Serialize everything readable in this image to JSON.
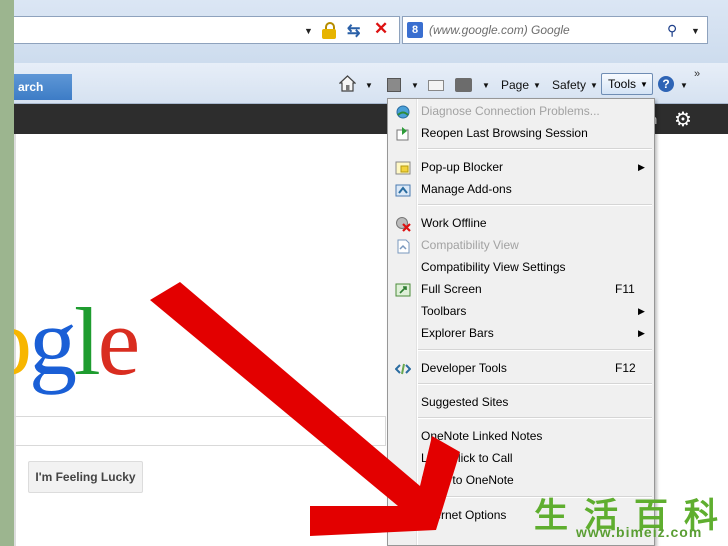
{
  "address_bar": {
    "dropdown_icon": "chevron-down",
    "lock_icon": "lock",
    "refresh_icon": "refresh",
    "stop_icon": "stop-x"
  },
  "search_box": {
    "provider_icon": "google-g",
    "provider_letter": "8",
    "placeholder": "(www.google.com) Google",
    "search_icon": "magnifier"
  },
  "tab": {
    "label": "arch"
  },
  "command_bar": {
    "home_icon": "home",
    "feeds_icon": "rss-feed",
    "mail_icon": "read-mail",
    "print_icon": "printer",
    "page": "Page",
    "safety": "Safety",
    "tools": "Tools",
    "help_glyph": "?",
    "overflow": "»"
  },
  "page_black_bar": {
    "partial_text": "n",
    "gear_icon": "gear"
  },
  "google_page": {
    "logo_text": "oogle",
    "lucky_button": "I'm Feeling Lucky"
  },
  "tools_menu": {
    "groups": [
      [
        {
          "label": "Diagnose Connection Problems...",
          "disabled": true,
          "icon": "diagnose-globe"
        },
        {
          "label": "Reopen Last Browsing Session",
          "disabled": false,
          "icon": "reopen-session"
        }
      ],
      [
        {
          "label": "Pop-up Blocker",
          "submenu": true,
          "icon": "popup-blocker"
        },
        {
          "label": "Manage Add-ons",
          "icon": "addons"
        }
      ],
      [
        {
          "label": "Work Offline",
          "icon": "work-offline"
        },
        {
          "label": "Compatibility View",
          "disabled": true,
          "icon": "compat-view"
        },
        {
          "label": "Compatibility View Settings"
        },
        {
          "label": "Full Screen",
          "shortcut": "F11",
          "icon": "fullscreen"
        },
        {
          "label": "Toolbars",
          "submenu": true
        },
        {
          "label": "Explorer Bars",
          "submenu": true
        }
      ],
      [
        {
          "label": "Developer Tools",
          "shortcut": "F12",
          "icon": "developer-tools"
        }
      ],
      [
        {
          "label": "Suggested Sites"
        }
      ],
      [
        {
          "label": "OneNote Linked Notes"
        },
        {
          "label": "Lync Click to Call"
        },
        {
          "label": "Send to OneNote"
        }
      ],
      [
        {
          "label": "Internet Options",
          "icon": "internet-options"
        }
      ]
    ]
  },
  "annotation": {
    "arrow_color": "#e30000",
    "arrow_icon": "red-pointer-arrow"
  },
  "watermark": {
    "chinese": "生活百科",
    "url": "www.bimeiz.com"
  },
  "colors": {
    "frame_green": "#9cb58f",
    "tab_blue": "#3d7cc6",
    "black_bar": "#2d2d2d",
    "menu_bg": "#f0f0f0"
  }
}
